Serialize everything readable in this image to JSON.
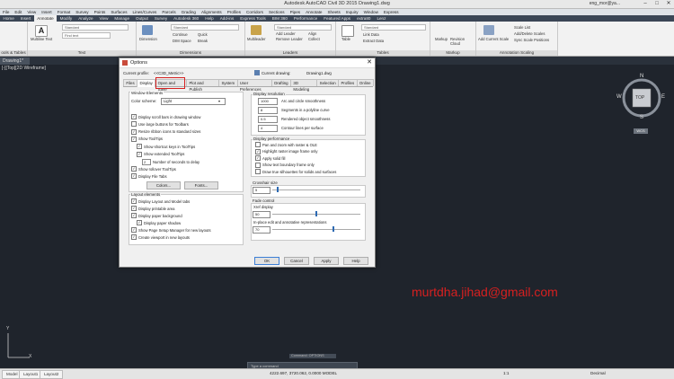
{
  "window": {
    "title": "Autodesk AutoCAD Civil 3D 2015   Drawing1.dwg",
    "user": "eng_mor@ya...",
    "controls": [
      "–",
      "□",
      "✕"
    ]
  },
  "menubar": [
    "File",
    "Edit",
    "View",
    "Insert",
    "Format",
    "Survey",
    "Points",
    "Surfaces",
    "Lines/Curves",
    "Parcels",
    "Grading",
    "Alignments",
    "Profiles",
    "Corridors",
    "Sections",
    "Pipes",
    "Annotate",
    "Sheets",
    "Inquiry",
    "Window",
    "Express"
  ],
  "ribbon_tabs": [
    "Home",
    "Insert",
    "Annotate",
    "Modify",
    "Analyze",
    "View",
    "Manage",
    "Output",
    "Survey",
    "Autodesk 360",
    "Help",
    "Add-ins",
    "Express Tools",
    "BIM 360",
    "Performance",
    "Featured Apps",
    "extra80",
    "Lenz"
  ],
  "active_ribbon_tab": "Annotate",
  "ribbon": {
    "panels": [
      "ools & Tables",
      "Text",
      "Dimensions",
      "Leaders",
      "Tables",
      "Markup",
      "Annotation Scaling"
    ],
    "text_panel": {
      "big": "Multiline Text",
      "combo1": "Standard",
      "combo2": "Find text"
    },
    "dim_panel": {
      "big": "Dimension",
      "combo": "Standard",
      "items": [
        "Continue",
        "Quick",
        "DIM Space",
        "Break"
      ]
    },
    "leader_panel": {
      "big": "Multileader",
      "combo": "Standard",
      "items": [
        "Add Leader",
        "Remove Leader",
        "Align",
        "Collect"
      ]
    },
    "tables_panel": {
      "big": "Table",
      "combo": "Standard",
      "items": [
        "Link Data",
        "Extract Data"
      ]
    },
    "markup_panel": {
      "items": [
        "Markup",
        "Revision Cloud"
      ]
    },
    "scaling_panel": {
      "big": "Add Current Scale",
      "items": [
        "Scale List",
        "Add/Delete Scales",
        "Sync Scale Positions"
      ]
    }
  },
  "file_tab": "Drawing1*",
  "view_label": "[-][Top][2D Wireframe]",
  "viewcube": {
    "top": "TOP",
    "n": "N",
    "s": "S",
    "e": "E",
    "w": "W",
    "wcs": "WCS"
  },
  "email": "murtdha.jihad@gmail.com",
  "ucs": {
    "x": "X",
    "y": "Y"
  },
  "command": {
    "hint": "Command: OPTIONS",
    "prompt": "Type a command"
  },
  "statusbar": {
    "layout_tabs": [
      "Model",
      "Layout1",
      "Layout2"
    ],
    "coords": "4222.697, 3720.062, 0.0000  MODEL",
    "scale": "1:1",
    "units": "Decimal"
  },
  "dialog": {
    "title": "Options",
    "current_profile_label": "Current profile:",
    "current_profile": "<<C3D_Metric>>",
    "current_drawing_label": "Current drawing:",
    "current_drawing": "Drawing1.dwg",
    "tabs": [
      "Files",
      "Display",
      "Open and Save",
      "Plot and Publish",
      "System",
      "User Preferences",
      "Drafting",
      "3D Modeling",
      "Selection",
      "Profiles",
      "Online"
    ],
    "active_tab": "Display",
    "window_elements": {
      "title": "Window Elements",
      "color_scheme_label": "Color scheme:",
      "color_scheme": "Light",
      "checks": [
        {
          "label": "Display scroll bars in drawing window",
          "checked": true
        },
        {
          "label": "Use large buttons for Toolbars",
          "checked": false
        },
        {
          "label": "Resize ribbon icons to standard sizes",
          "checked": true
        },
        {
          "label": "Show ToolTips",
          "checked": true
        },
        {
          "label": "Show shortcut keys in ToolTips",
          "checked": true
        },
        {
          "label": "Show extended ToolTips",
          "checked": true
        },
        {
          "label": "Number of seconds to delay",
          "value": "2"
        },
        {
          "label": "Show rollover ToolTips",
          "checked": true
        },
        {
          "label": "Display File Tabs",
          "checked": true
        }
      ],
      "colors_btn": "Colors...",
      "fonts_btn": "Fonts..."
    },
    "layout_elements": {
      "title": "Layout elements",
      "checks": [
        {
          "label": "Display Layout and Model tabs",
          "checked": true
        },
        {
          "label": "Display printable area",
          "checked": true
        },
        {
          "label": "Display paper background",
          "checked": true
        },
        {
          "label": "Display paper shadow",
          "checked": true
        },
        {
          "label": "Show Page Setup Manager for new layouts",
          "checked": true
        },
        {
          "label": "Create viewport in new layouts",
          "checked": true
        }
      ]
    },
    "display_resolution": {
      "title": "Display resolution",
      "items": [
        {
          "value": "1000",
          "label": "Arc and circle smoothness"
        },
        {
          "value": "8",
          "label": "Segments in a polyline curve"
        },
        {
          "value": "0.5",
          "label": "Rendered object smoothness"
        },
        {
          "value": "4",
          "label": "Contour lines per surface"
        }
      ]
    },
    "display_performance": {
      "title": "Display performance",
      "checks": [
        {
          "label": "Pan and zoom with raster & OLE",
          "checked": false
        },
        {
          "label": "Highlight raster image frame only",
          "checked": true
        },
        {
          "label": "Apply solid fill",
          "checked": true
        },
        {
          "label": "Show text boundary frame only",
          "checked": false
        },
        {
          "label": "Draw true silhouettes for solids and surfaces",
          "checked": false
        }
      ]
    },
    "crosshair": {
      "title": "Crosshair size",
      "value": "5",
      "fraction": 0.05
    },
    "fade": {
      "title": "Fade control",
      "xref_label": "Xref display",
      "xref_value": "50",
      "xref_fraction": 0.5,
      "inplace_label": "In-place edit and annotative representations",
      "inplace_value": "70",
      "inplace_fraction": 0.7
    },
    "buttons": {
      "ok": "OK",
      "cancel": "Cancel",
      "apply": "Apply",
      "help": "Help"
    }
  }
}
